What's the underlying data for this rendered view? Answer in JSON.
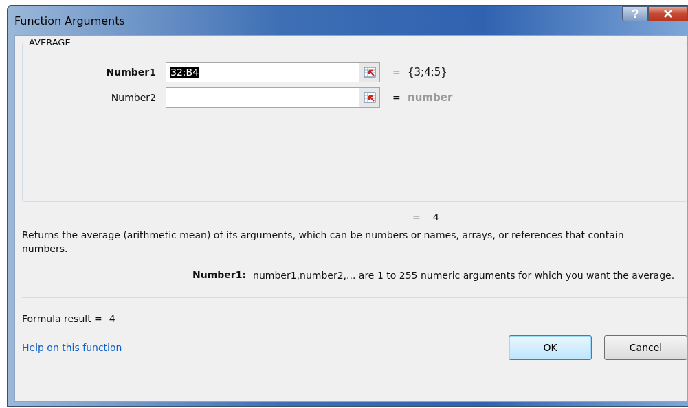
{
  "window": {
    "title": "Function Arguments"
  },
  "function_group": {
    "name": "AVERAGE",
    "arguments": [
      {
        "label": "Number1",
        "active": true,
        "value": "32:B4",
        "value_selected": true,
        "equals": "=",
        "result": "{3;4;5}",
        "result_dimmed": false
      },
      {
        "label": "Number2",
        "active": false,
        "equals": "=",
        "result": "number",
        "result_dimmed": true
      }
    ]
  },
  "total_equals": "=",
  "total_result": "4",
  "description": "Returns the average (arithmetic mean) of its arguments, which can be numbers or names, arrays, or references that contain numbers.",
  "argument_help": {
    "label": "Number1:",
    "text": "number1,number2,... are 1 to 255 numeric arguments for which you want the average."
  },
  "formula_result": {
    "label": "Formula result =",
    "value": "4"
  },
  "help_link": "Help on this function",
  "buttons": [
    {
      "label": "OK",
      "default": true
    },
    {
      "label": "Cancel",
      "default": false
    }
  ]
}
